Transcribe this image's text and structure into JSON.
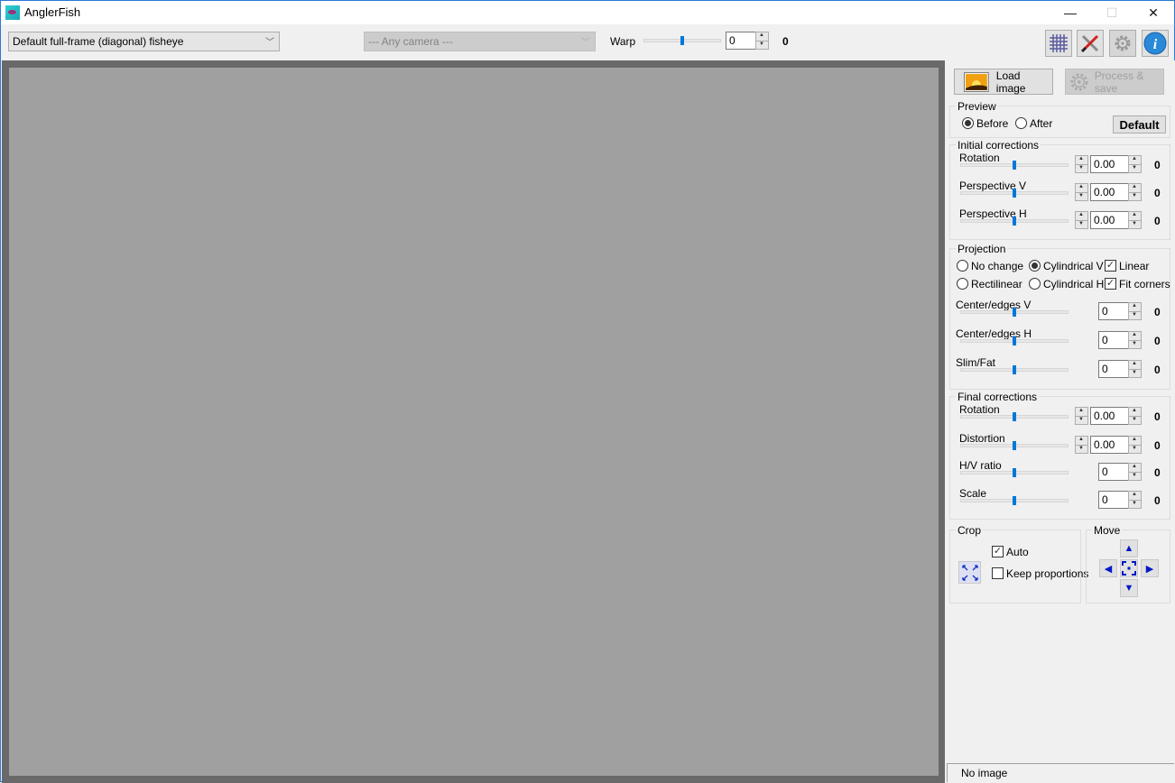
{
  "window": {
    "title": "AnglerFish",
    "minimize": "—",
    "maximize": "☐",
    "close": "✕"
  },
  "toolbar": {
    "lens_profile": "Default full-frame (diagonal) fisheye",
    "camera": "--- Any camera ---",
    "warp_label": "Warp",
    "warp_value": "0",
    "warp_display": "0",
    "warp_fraction": 0.5,
    "icons": [
      "grid-icon",
      "tools-icon",
      "settings-icon",
      "info-icon"
    ]
  },
  "panel": {
    "load_image": "Load image",
    "process_save": "Process & save",
    "preview": {
      "title": "Preview",
      "before": "Before",
      "after": "After",
      "selected": "Before",
      "default_button": "Default"
    },
    "initial": {
      "title": "Initial corrections",
      "rows": [
        {
          "label": "Rotation",
          "value": "0.00",
          "display": "0"
        },
        {
          "label": "Perspective V",
          "value": "0.00",
          "display": "0"
        },
        {
          "label": "Perspective H",
          "value": "0.00",
          "display": "0"
        }
      ]
    },
    "projection": {
      "title": "Projection",
      "no_change": "No change",
      "cyl_v": "Cylindrical V",
      "linear": "Linear",
      "rectilinear": "Rectilinear",
      "cyl_h": "Cylindrical H",
      "fit_corners": "Fit corners",
      "selected": "Cylindrical V",
      "linear_checked": true,
      "fit_corners_checked": true,
      "rows": [
        {
          "label": "Center/edges V",
          "value": "0",
          "display": "0"
        },
        {
          "label": "Center/edges H",
          "value": "0",
          "display": "0"
        },
        {
          "label": "Slim/Fat",
          "value": "0",
          "display": "0"
        }
      ]
    },
    "final": {
      "title": "Final corrections",
      "rows": [
        {
          "label": "Rotation",
          "value": "0.00",
          "display": "0"
        },
        {
          "label": "Distortion",
          "value": "0.00",
          "display": "0"
        },
        {
          "label": "H/V ratio",
          "value": "0",
          "display": "0"
        },
        {
          "label": "Scale",
          "value": "0",
          "display": "0"
        }
      ]
    },
    "crop": {
      "title": "Crop",
      "auto": "Auto",
      "auto_checked": true,
      "keep_proportions": "Keep proportions",
      "keep_checked": false
    },
    "move": {
      "title": "Move"
    }
  },
  "status": {
    "text": "No image"
  }
}
